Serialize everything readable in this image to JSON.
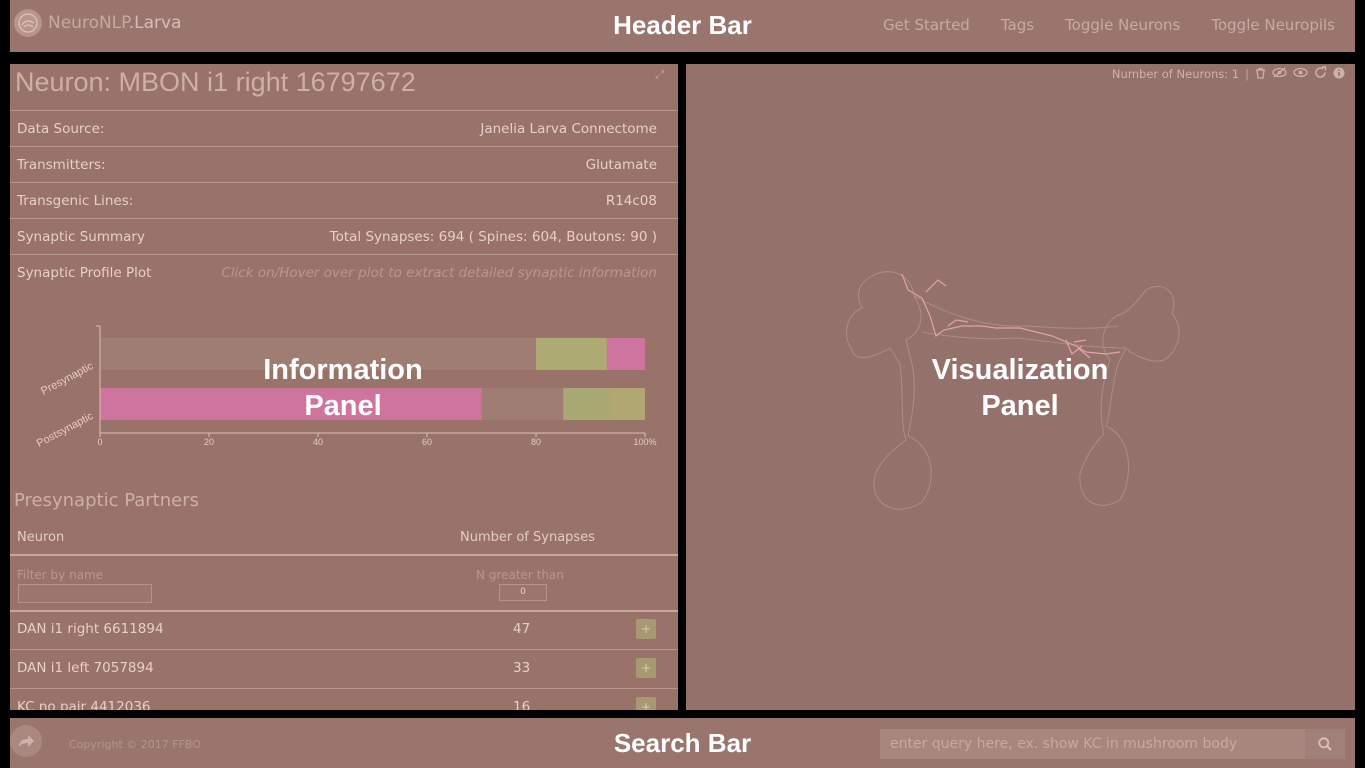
{
  "header": {
    "brand_main": "NeuroNLP",
    "brand_sub": ".Larva",
    "overlay_label": "Header Bar",
    "nav": [
      "Get Started",
      "Tags",
      "Toggle Neurons",
      "Toggle Neuropils"
    ]
  },
  "info": {
    "title": "Neuron: MBON i1 right 16797672",
    "overlay_label_line1": "Information",
    "overlay_label_line2": "Panel",
    "rows": [
      {
        "label": "Data Source:",
        "value": "Janelia Larva Connectome"
      },
      {
        "label": "Transmitters:",
        "value": "Glutamate"
      },
      {
        "label": "Transgenic Lines:",
        "value": "R14c08"
      },
      {
        "label": "Synaptic Summary",
        "value": "Total Synapses: 694 ( Spines: 604, Boutons: 90 )"
      },
      {
        "label": "Synaptic Profile Plot",
        "value": "Click on/Hover over plot to extract detailed synaptic information"
      }
    ]
  },
  "chart_data": {
    "type": "bar",
    "orientation": "horizontal",
    "stacked": true,
    "categories": [
      "Presynaptic",
      "Postsynaptic"
    ],
    "xlim": [
      0,
      100
    ],
    "x_ticks": [
      "0",
      "20",
      "40",
      "60",
      "80",
      "100%"
    ],
    "segments": [
      [
        {
          "start": 0,
          "end": 80,
          "color": "#a07d72"
        },
        {
          "start": 80,
          "end": 93,
          "color": "#adaa73"
        },
        {
          "start": 93,
          "end": 100,
          "color": "#cf749f"
        }
      ],
      [
        {
          "start": 0,
          "end": 70,
          "color": "#cf749f"
        },
        {
          "start": 70,
          "end": 85,
          "color": "#a07d72"
        },
        {
          "start": 85,
          "end": 93.5,
          "color": "#a9aa73"
        },
        {
          "start": 93.5,
          "end": 100,
          "color": "#b0a772"
        }
      ]
    ]
  },
  "partners": {
    "title": "Presynaptic Partners",
    "col_neuron": "Neuron",
    "col_synapses": "Number of Synapses",
    "filter_name_label": "Filter by name",
    "filter_n_label": "N greater than",
    "filter_n_value": "0",
    "add_glyph": "+",
    "rows": [
      {
        "name": "DAN i1 right 6611894",
        "synapses": "47"
      },
      {
        "name": "DAN i1 left 7057894",
        "synapses": "33"
      },
      {
        "name": "KC no pair 4412036",
        "synapses": "16"
      }
    ]
  },
  "vis": {
    "neuron_count_label": "Number of Neurons: 1",
    "overlay_label_line1": "Visualization",
    "overlay_label_line2": "Panel",
    "icons": [
      "trash-icon",
      "hide-icon",
      "show-icon",
      "refresh-icon",
      "info-icon"
    ]
  },
  "search": {
    "overlay_label": "Search Bar",
    "copyright": "Copyright © 2017 FFBO",
    "placeholder": "enter query here, ex. show KC in mushroom body"
  }
}
